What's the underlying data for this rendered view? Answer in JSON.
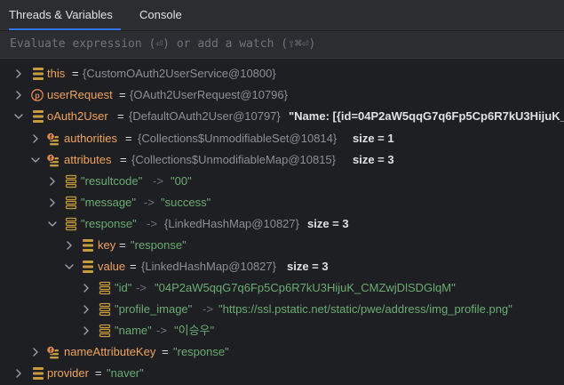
{
  "tabs": {
    "threads_label": "Threads & Variables",
    "console_label": "Console"
  },
  "eval": {
    "placeholder": "Evaluate expression (⏎) or add a watch (⇧⌘⏎)"
  },
  "colors": {
    "accent": "#3574f0",
    "background": "#1e1f22",
    "toolbar": "#2b2d30",
    "variable_name": "#f0a35b",
    "string_value": "#6aab73",
    "type_ref": "#8c8f94",
    "icon_field": "#c89c3e",
    "icon_param": "#e08855"
  },
  "tree": {
    "this": {
      "icon": "field-icon",
      "name": "this",
      "eq": "=",
      "value": "{CustomOAuth2UserService@10800}"
    },
    "userRequest": {
      "icon": "parameter-icon",
      "name": "userRequest",
      "eq": "=",
      "value": "{OAuth2UserRequest@10796}"
    },
    "oAuth2User": {
      "icon": "field-icon",
      "name": "oAuth2User",
      "eq": "=",
      "value": "{DefaultOAuth2User@10797}",
      "preview": "\"Name: [{id=04P2aW5qqG7q6Fp5Cp6R7kU3HijuK_"
    },
    "authorities": {
      "icon": "lambda-field-icon",
      "name": "authorities",
      "eq": "=",
      "value": "{Collections$UnmodifiableSet@10814}",
      "size": "size = 1"
    },
    "attributes": {
      "icon": "lambda-field-icon",
      "name": "attributes",
      "eq": "=",
      "value": "{Collections$UnmodifiableMap@10815}",
      "size": "size = 3"
    },
    "resultcode": {
      "icon": "map-entry-icon",
      "key": "\"resultcode\"",
      "arrow": "->",
      "value": "\"00\""
    },
    "message": {
      "icon": "map-entry-icon",
      "key": "\"message\"",
      "arrow": "->",
      "value": "\"success\""
    },
    "response": {
      "icon": "map-entry-icon",
      "key": "\"response\"",
      "arrow": "->",
      "value": "{LinkedHashMap@10827}",
      "size": "size = 3"
    },
    "entry_key": {
      "icon": "field-icon",
      "name": "key",
      "eq": "=",
      "value": "\"response\""
    },
    "entry_value": {
      "icon": "field-icon",
      "name": "value",
      "eq": "=",
      "value": "{LinkedHashMap@10827}",
      "size": "size = 3"
    },
    "id": {
      "icon": "map-entry-icon",
      "key": "\"id\"",
      "arrow": "->",
      "value": "\"04P2aW5qqG7q6Fp5Cp6R7kU3HijuK_CMZwjDlSDGlqM\""
    },
    "profile_image": {
      "icon": "map-entry-icon",
      "key": "\"profile_image\"",
      "arrow": "->",
      "value": "\"https://ssl.pstatic.net/static/pwe/address/img_profile.png\""
    },
    "name": {
      "icon": "map-entry-icon",
      "key": "\"name\"",
      "arrow": "->",
      "value": "\"이승우\""
    },
    "nameAttributeKey": {
      "icon": "lambda-field-icon",
      "name": "nameAttributeKey",
      "eq": "=",
      "value": "\"response\""
    },
    "provider": {
      "icon": "field-icon",
      "name": "provider",
      "eq": "=",
      "value": "\"naver\""
    }
  }
}
